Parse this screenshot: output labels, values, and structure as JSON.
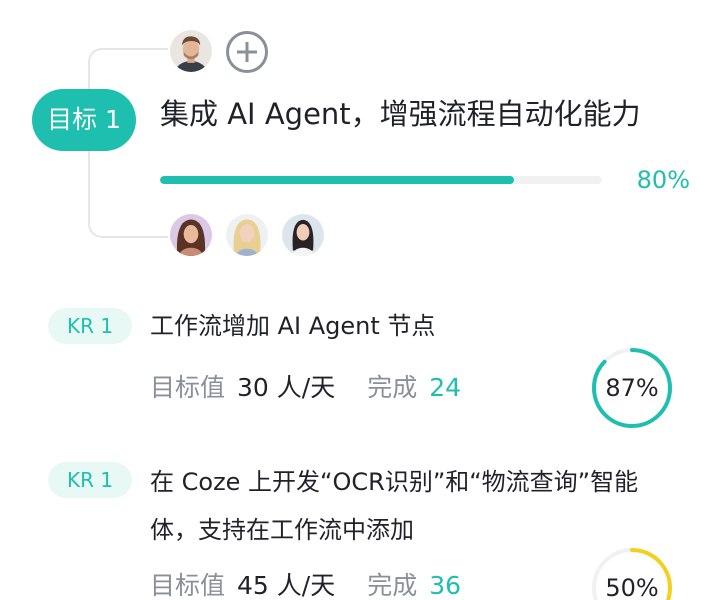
{
  "objective": {
    "tag": "目标 1",
    "title": "集成 AI Agent，增强流程自动化能力",
    "progress_text": "80%",
    "progress_value": 80,
    "accent_color": "#1fbfaf"
  },
  "owner_avatar": "man-avatar",
  "add_label_icon": "plus-circle-icon",
  "member_avatars": [
    "woman-brunette-avatar",
    "woman-blonde-avatar",
    "woman-darkhair-avatar"
  ],
  "key_results": [
    {
      "tag": "KR 1",
      "title": "工作流增加 AI Agent 节点",
      "target_label": "目标值",
      "target_value": "30 人/天",
      "done_label": "完成",
      "done_value": "24",
      "percent_text": "87%",
      "percent_value": 87,
      "ring_color": "#1fbfaf"
    },
    {
      "tag": "KR 1",
      "title": "在 Coze 上开发“OCR识别”和“物流查询”智能体，支持在工作流中添加",
      "target_label": "目标值",
      "target_value": "45 人/天",
      "done_label": "完成",
      "done_value": "36",
      "percent_text": "50%",
      "percent_value": 50,
      "ring_color": "#f5cf1f"
    }
  ]
}
